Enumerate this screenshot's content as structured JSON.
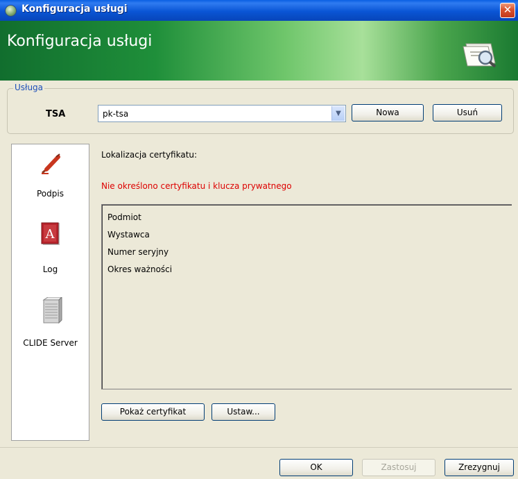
{
  "window": {
    "title": "Konfiguracja usługi",
    "close_icon": "close-icon"
  },
  "banner": {
    "title": "Konfiguracja usługi",
    "icon": "document-search-icon"
  },
  "service": {
    "legend": "Usługa",
    "label": "TSA",
    "selected": "pk-tsa",
    "new_label": "Nowa",
    "delete_label": "Usuń"
  },
  "sidebar": {
    "items": [
      {
        "label": "Podpis",
        "icon": "pen-icon"
      },
      {
        "label": "Log",
        "icon": "log-book-icon"
      },
      {
        "label": "CLIDE Server",
        "icon": "server-icon"
      }
    ]
  },
  "content": {
    "cert_location_label": "Lokalizacja certyfikatu:",
    "error_text": "Nie określono certyfikatu i klucza prywatnego",
    "error_color": "#dd0000",
    "fields": [
      "Podmiot",
      "Wystawca",
      "Numer seryjny",
      "Okres ważności"
    ],
    "show_cert_label": "Pokaż certyfikat",
    "set_label": "Ustaw..."
  },
  "footer": {
    "ok_label": "OK",
    "apply_label": "Zastosuj",
    "cancel_label": "Zrezygnuj"
  }
}
